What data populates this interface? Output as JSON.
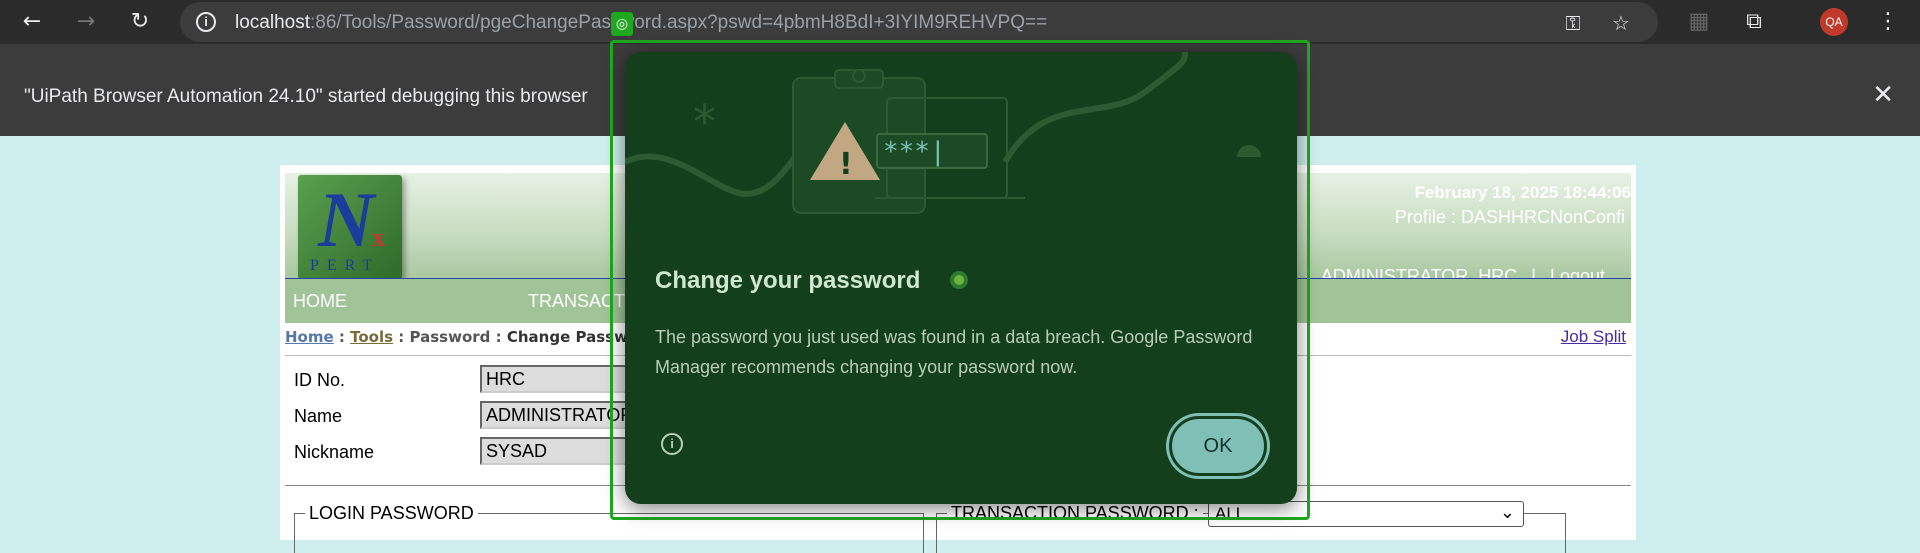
{
  "browser": {
    "url_host": "localhost",
    "url_rest": ":86/Tools/Password/pgeChangePassword.aspx?pswd=4pbmH8BdI+3IYIM9REHVPQ==",
    "avatar_initials": "QA",
    "icons": [
      "back-arrow-icon",
      "forward-arrow-icon",
      "reload-icon",
      "site-info-icon",
      "key-icon",
      "star-icon",
      "extensions-icon",
      "puzzle-icon",
      "kebab-menu-icon"
    ]
  },
  "debug_banner": {
    "text": "\"UiPath Browser Automation 24.10\" started debugging this browser"
  },
  "page": {
    "datetime": "February 18, 2025 18:44:06",
    "profile": "Profile : DASHHRCNonConfi",
    "user": "ADMINISTRATOR, HRC",
    "separator": "|",
    "logout": "Logout",
    "logo": {
      "letter": "N",
      "sup": "x",
      "word": "PERT"
    },
    "menu": {
      "home": "HOME",
      "transactions": "TRANSACTIONS"
    },
    "breadcrumb": {
      "home": "Home",
      "sep": ":",
      "tools": "Tools",
      "password": "Password",
      "current": "Change Password"
    },
    "job_split": "Job Split",
    "fields": [
      {
        "label": "ID No.",
        "value": "HRC"
      },
      {
        "label": "Name",
        "value": "ADMINISTRATOR, HRC"
      },
      {
        "label": "Nickname",
        "value": "SYSAD"
      }
    ],
    "login_password_legend": "LOGIN PASSWORD",
    "transaction_password_legend": "TRANSACTION PASSWORD :",
    "transaction_select_value": "ALL"
  },
  "dialog": {
    "title": "Change your password",
    "body": "The password you just used was found in a data breach. Google Password Manager recommends changing your password now.",
    "ok_label": "OK",
    "masked_text": "***|",
    "colors": {
      "background": "#133f1d",
      "button": "#7fbfb6",
      "highlight": "#1fa81f"
    }
  }
}
